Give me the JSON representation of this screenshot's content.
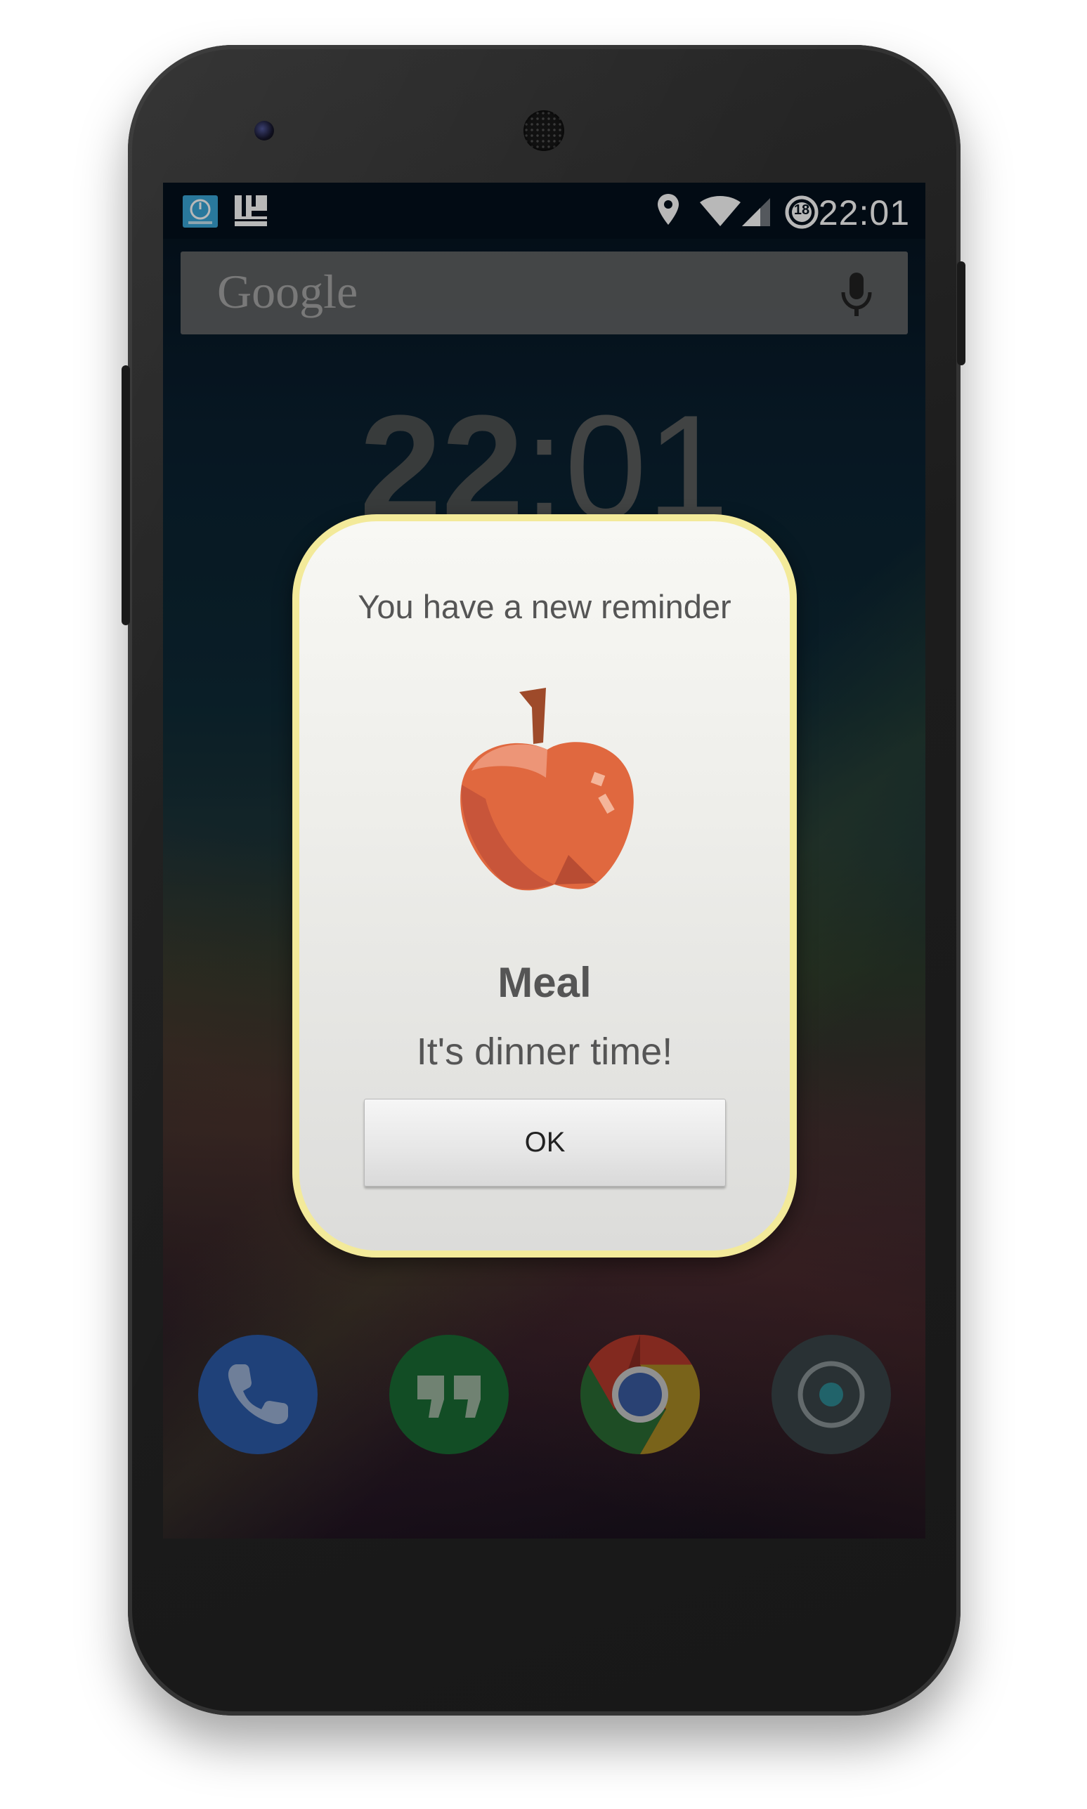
{
  "status_bar": {
    "time": "22:01",
    "notification_icons": [
      "timer-app-icon",
      "layout-app-icon"
    ],
    "system_icons": [
      "location-icon",
      "wifi-icon",
      "cell-signal-icon",
      "data-saver-icon"
    ],
    "badge_count": "18"
  },
  "search": {
    "logo_text": "Google",
    "mic_icon": "microphone-icon"
  },
  "lock_clock": {
    "hours": "22",
    "separator": ":",
    "minutes": "01"
  },
  "dock": {
    "apps": [
      {
        "name": "Phone",
        "icon": "phone-icon",
        "color": "#2b5aa8"
      },
      {
        "name": "Hangouts",
        "icon": "hangouts-icon",
        "color": "#1a6b34"
      },
      {
        "name": "Chrome",
        "icon": "chrome-icon",
        "color": "#c7352b"
      },
      {
        "name": "Camera",
        "icon": "camera-icon",
        "color": "#3a4548"
      }
    ]
  },
  "dialog": {
    "heading": "You have a new reminder",
    "icon": "apple-icon",
    "title": "Meal",
    "message": "It's dinner time!",
    "ok_label": "OK",
    "border_color": "#f3ea9a",
    "apple_color": "#e0683f"
  }
}
